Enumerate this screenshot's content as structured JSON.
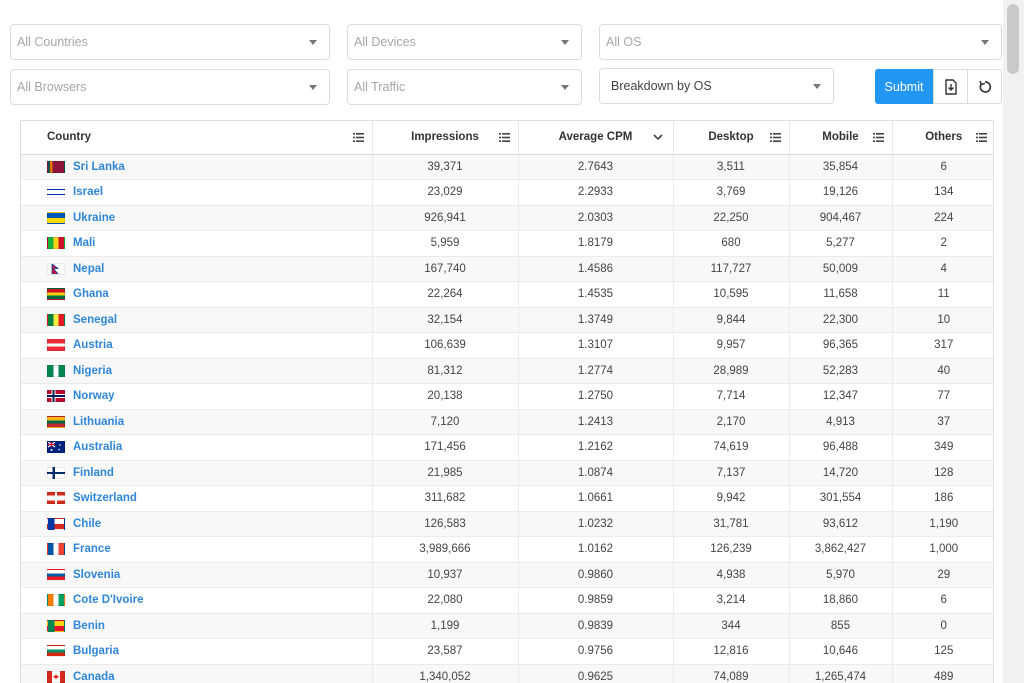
{
  "filters": {
    "countries": "All Countries",
    "devices": "All Devices",
    "os": "All OS",
    "browsers": "All Browsers",
    "traffic": "All Traffic",
    "breakdown": "Breakdown by OS"
  },
  "actions": {
    "submit_label": "Submit",
    "download_icon": "download-icon",
    "reset_icon": "reset-icon"
  },
  "colors": {
    "accent": "#2196f3",
    "link": "#2f86d8"
  },
  "table": {
    "columns": [
      "Country",
      "Impressions",
      "Average CPM",
      "Desktop",
      "Mobile",
      "Others"
    ],
    "rows": [
      {
        "country": "Sri Lanka",
        "flag": "lk",
        "impressions": "39,371",
        "cpm": "2.7643",
        "desktop": "3,511",
        "mobile": "35,854",
        "others": "6"
      },
      {
        "country": "Israel",
        "flag": "il",
        "impressions": "23,029",
        "cpm": "2.2933",
        "desktop": "3,769",
        "mobile": "19,126",
        "others": "134"
      },
      {
        "country": "Ukraine",
        "flag": "ua",
        "impressions": "926,941",
        "cpm": "2.0303",
        "desktop": "22,250",
        "mobile": "904,467",
        "others": "224"
      },
      {
        "country": "Mali",
        "flag": "ml",
        "impressions": "5,959",
        "cpm": "1.8179",
        "desktop": "680",
        "mobile": "5,277",
        "others": "2"
      },
      {
        "country": "Nepal",
        "flag": "np",
        "impressions": "167,740",
        "cpm": "1.4586",
        "desktop": "117,727",
        "mobile": "50,009",
        "others": "4"
      },
      {
        "country": "Ghana",
        "flag": "gh",
        "impressions": "22,264",
        "cpm": "1.4535",
        "desktop": "10,595",
        "mobile": "11,658",
        "others": "11"
      },
      {
        "country": "Senegal",
        "flag": "sn",
        "impressions": "32,154",
        "cpm": "1.3749",
        "desktop": "9,844",
        "mobile": "22,300",
        "others": "10"
      },
      {
        "country": "Austria",
        "flag": "at",
        "impressions": "106,639",
        "cpm": "1.3107",
        "desktop": "9,957",
        "mobile": "96,365",
        "others": "317"
      },
      {
        "country": "Nigeria",
        "flag": "ng",
        "impressions": "81,312",
        "cpm": "1.2774",
        "desktop": "28,989",
        "mobile": "52,283",
        "others": "40"
      },
      {
        "country": "Norway",
        "flag": "no",
        "impressions": "20,138",
        "cpm": "1.2750",
        "desktop": "7,714",
        "mobile": "12,347",
        "others": "77"
      },
      {
        "country": "Lithuania",
        "flag": "lt",
        "impressions": "7,120",
        "cpm": "1.2413",
        "desktop": "2,170",
        "mobile": "4,913",
        "others": "37"
      },
      {
        "country": "Australia",
        "flag": "au",
        "impressions": "171,456",
        "cpm": "1.2162",
        "desktop": "74,619",
        "mobile": "96,488",
        "others": "349"
      },
      {
        "country": "Finland",
        "flag": "fi",
        "impressions": "21,985",
        "cpm": "1.0874",
        "desktop": "7,137",
        "mobile": "14,720",
        "others": "128"
      },
      {
        "country": "Switzerland",
        "flag": "ch",
        "impressions": "311,682",
        "cpm": "1.0661",
        "desktop": "9,942",
        "mobile": "301,554",
        "others": "186"
      },
      {
        "country": "Chile",
        "flag": "cl",
        "impressions": "126,583",
        "cpm": "1.0232",
        "desktop": "31,781",
        "mobile": "93,612",
        "others": "1,190"
      },
      {
        "country": "France",
        "flag": "fr",
        "impressions": "3,989,666",
        "cpm": "1.0162",
        "desktop": "126,239",
        "mobile": "3,862,427",
        "others": "1,000"
      },
      {
        "country": "Slovenia",
        "flag": "si",
        "impressions": "10,937",
        "cpm": "0.9860",
        "desktop": "4,938",
        "mobile": "5,970",
        "others": "29"
      },
      {
        "country": "Cote D'Ivoire",
        "flag": "ci",
        "impressions": "22,080",
        "cpm": "0.9859",
        "desktop": "3,214",
        "mobile": "18,860",
        "others": "6"
      },
      {
        "country": "Benin",
        "flag": "bj",
        "impressions": "1,199",
        "cpm": "0.9839",
        "desktop": "344",
        "mobile": "855",
        "others": "0"
      },
      {
        "country": "Bulgaria",
        "flag": "bg",
        "impressions": "23,587",
        "cpm": "0.9756",
        "desktop": "12,816",
        "mobile": "10,646",
        "others": "125"
      },
      {
        "country": "Canada",
        "flag": "ca",
        "impressions": "1,340,052",
        "cpm": "0.9625",
        "desktop": "74,089",
        "mobile": "1,265,474",
        "others": "489"
      }
    ]
  }
}
